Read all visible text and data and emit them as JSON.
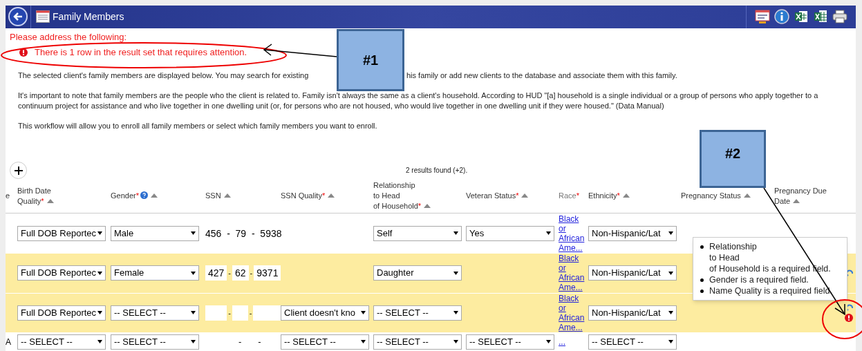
{
  "window": {
    "title": "Family Members"
  },
  "alert": {
    "heading": "Please address the following:",
    "message": "There is 1 row in the result set that requires attention."
  },
  "paragraphs": [
    [
      "The selected client's family members are displayed below. You may search for existing",
      "his family or add new clients to the database and associate them with this family."
    ],
    [
      "It's important to note that family members are the people who the client is related to. Family isn't always the same as a client's household. According to HUD \"[a] household is a single individual or a group of persons who apply together to a continuum project for assistance and who live together in one dwelling unit (or, for persons who are not housed, who would live together in one dwelling unit if they were housed.\" (Data Manual)"
    ],
    [
      "This workflow will allow you to enroll all family members or select which family members you want to enroll."
    ]
  ],
  "results_count": "2 results found (+2).",
  "columns": [
    {
      "label": "e",
      "sortable": false,
      "muted": false
    },
    {
      "label": "Birth Date\nQuality",
      "mark": "*",
      "sortable": true,
      "muted": false
    },
    {
      "label": "Gender",
      "mark": "*",
      "help": true,
      "sortable": true,
      "muted": false
    },
    {
      "label": "SSN",
      "sortable": true,
      "muted": false
    },
    {
      "label": "SSN Quality",
      "mark": "*",
      "sortable": true,
      "muted": false
    },
    {
      "label": "Relationship\nto Head\nof Household",
      "mark": "*",
      "sortable": true,
      "muted": false
    },
    {
      "label": "Veteran Status",
      "mark": "*",
      "sortable": true,
      "muted": false
    },
    {
      "label": "Race",
      "mark": "*",
      "sortable": false,
      "muted": true
    },
    {
      "label": "Ethnicity",
      "mark": "*",
      "sortable": true,
      "muted": false
    },
    {
      "label": "Pregnancy Status",
      "sortable": true,
      "muted": false
    },
    {
      "label": "Pregnancy Due\nDate",
      "sortable": true,
      "muted": false
    }
  ],
  "rows": [
    {
      "highlighted": false,
      "action_icon": false,
      "error": false,
      "birth_date_quality": "Full DOB Reportec",
      "gender": "Male",
      "ssn": {
        "boxed": false,
        "separator": "-",
        "parts": [
          "456",
          "79",
          "5938"
        ]
      },
      "relationship": "Self",
      "veteran_status": "Yes",
      "race": "Black or African Ame...",
      "ethnicity": "Non-Hispanic/Lat"
    },
    {
      "highlighted": true,
      "action_icon": true,
      "error": false,
      "birth_date_quality": "Full DOB Reportec",
      "gender": "Female",
      "ssn": {
        "boxed": true,
        "separator": "-",
        "parts": [
          "427",
          "62",
          "9371"
        ]
      },
      "relationship": "Daughter",
      "race": "Black or African Ame...",
      "ethnicity": "Non-Hispanic/Lat"
    },
    {
      "highlighted": true,
      "action_icon": true,
      "error": true,
      "birth_date_quality": "Full DOB Reportec",
      "gender": "-- SELECT --",
      "ssn": {
        "boxed": true,
        "separator": "-"
      },
      "ssn_quality": "Client doesn't kno",
      "relationship": "-- SELECT --",
      "race": "Black or African Ame...",
      "ethnicity": "Non-Hispanic/Lat"
    },
    {
      "highlighted": false,
      "action_icon": false,
      "error": false,
      "lead": "A",
      "birth_date_quality": "-- SELECT --",
      "gender": "-- SELECT --",
      "ssn": {
        "boxed": false,
        "separator": "-"
      },
      "ssn_quality": "-- SELECT --",
      "relationship": "-- SELECT --",
      "veteran_status": "-- SELECT --",
      "race": "...",
      "ethnicity": "-- SELECT --"
    }
  ],
  "tooltip": {
    "items": [
      "Relationship\nto Head\nof Household is a required field.",
      "Gender is a required field.",
      "Name Quality is a required field."
    ]
  },
  "callouts": [
    {
      "label": "#1"
    },
    {
      "label": "#2"
    }
  ]
}
